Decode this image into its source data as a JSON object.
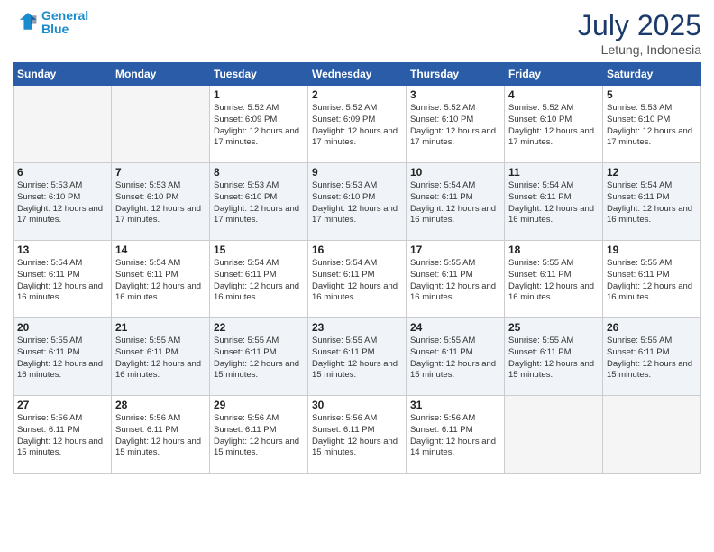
{
  "header": {
    "logo_line1": "General",
    "logo_line2": "Blue",
    "month": "July 2025",
    "location": "Letung, Indonesia"
  },
  "days_of_week": [
    "Sunday",
    "Monday",
    "Tuesday",
    "Wednesday",
    "Thursday",
    "Friday",
    "Saturday"
  ],
  "weeks": [
    [
      {
        "day": "",
        "empty": true
      },
      {
        "day": "",
        "empty": true
      },
      {
        "day": "1",
        "sunrise": "Sunrise: 5:52 AM",
        "sunset": "Sunset: 6:09 PM",
        "daylight": "Daylight: 12 hours and 17 minutes."
      },
      {
        "day": "2",
        "sunrise": "Sunrise: 5:52 AM",
        "sunset": "Sunset: 6:09 PM",
        "daylight": "Daylight: 12 hours and 17 minutes."
      },
      {
        "day": "3",
        "sunrise": "Sunrise: 5:52 AM",
        "sunset": "Sunset: 6:10 PM",
        "daylight": "Daylight: 12 hours and 17 minutes."
      },
      {
        "day": "4",
        "sunrise": "Sunrise: 5:52 AM",
        "sunset": "Sunset: 6:10 PM",
        "daylight": "Daylight: 12 hours and 17 minutes."
      },
      {
        "day": "5",
        "sunrise": "Sunrise: 5:53 AM",
        "sunset": "Sunset: 6:10 PM",
        "daylight": "Daylight: 12 hours and 17 minutes."
      }
    ],
    [
      {
        "day": "6",
        "sunrise": "Sunrise: 5:53 AM",
        "sunset": "Sunset: 6:10 PM",
        "daylight": "Daylight: 12 hours and 17 minutes."
      },
      {
        "day": "7",
        "sunrise": "Sunrise: 5:53 AM",
        "sunset": "Sunset: 6:10 PM",
        "daylight": "Daylight: 12 hours and 17 minutes."
      },
      {
        "day": "8",
        "sunrise": "Sunrise: 5:53 AM",
        "sunset": "Sunset: 6:10 PM",
        "daylight": "Daylight: 12 hours and 17 minutes."
      },
      {
        "day": "9",
        "sunrise": "Sunrise: 5:53 AM",
        "sunset": "Sunset: 6:10 PM",
        "daylight": "Daylight: 12 hours and 17 minutes."
      },
      {
        "day": "10",
        "sunrise": "Sunrise: 5:54 AM",
        "sunset": "Sunset: 6:11 PM",
        "daylight": "Daylight: 12 hours and 16 minutes."
      },
      {
        "day": "11",
        "sunrise": "Sunrise: 5:54 AM",
        "sunset": "Sunset: 6:11 PM",
        "daylight": "Daylight: 12 hours and 16 minutes."
      },
      {
        "day": "12",
        "sunrise": "Sunrise: 5:54 AM",
        "sunset": "Sunset: 6:11 PM",
        "daylight": "Daylight: 12 hours and 16 minutes."
      }
    ],
    [
      {
        "day": "13",
        "sunrise": "Sunrise: 5:54 AM",
        "sunset": "Sunset: 6:11 PM",
        "daylight": "Daylight: 12 hours and 16 minutes."
      },
      {
        "day": "14",
        "sunrise": "Sunrise: 5:54 AM",
        "sunset": "Sunset: 6:11 PM",
        "daylight": "Daylight: 12 hours and 16 minutes."
      },
      {
        "day": "15",
        "sunrise": "Sunrise: 5:54 AM",
        "sunset": "Sunset: 6:11 PM",
        "daylight": "Daylight: 12 hours and 16 minutes."
      },
      {
        "day": "16",
        "sunrise": "Sunrise: 5:54 AM",
        "sunset": "Sunset: 6:11 PM",
        "daylight": "Daylight: 12 hours and 16 minutes."
      },
      {
        "day": "17",
        "sunrise": "Sunrise: 5:55 AM",
        "sunset": "Sunset: 6:11 PM",
        "daylight": "Daylight: 12 hours and 16 minutes."
      },
      {
        "day": "18",
        "sunrise": "Sunrise: 5:55 AM",
        "sunset": "Sunset: 6:11 PM",
        "daylight": "Daylight: 12 hours and 16 minutes."
      },
      {
        "day": "19",
        "sunrise": "Sunrise: 5:55 AM",
        "sunset": "Sunset: 6:11 PM",
        "daylight": "Daylight: 12 hours and 16 minutes."
      }
    ],
    [
      {
        "day": "20",
        "sunrise": "Sunrise: 5:55 AM",
        "sunset": "Sunset: 6:11 PM",
        "daylight": "Daylight: 12 hours and 16 minutes."
      },
      {
        "day": "21",
        "sunrise": "Sunrise: 5:55 AM",
        "sunset": "Sunset: 6:11 PM",
        "daylight": "Daylight: 12 hours and 16 minutes."
      },
      {
        "day": "22",
        "sunrise": "Sunrise: 5:55 AM",
        "sunset": "Sunset: 6:11 PM",
        "daylight": "Daylight: 12 hours and 15 minutes."
      },
      {
        "day": "23",
        "sunrise": "Sunrise: 5:55 AM",
        "sunset": "Sunset: 6:11 PM",
        "daylight": "Daylight: 12 hours and 15 minutes."
      },
      {
        "day": "24",
        "sunrise": "Sunrise: 5:55 AM",
        "sunset": "Sunset: 6:11 PM",
        "daylight": "Daylight: 12 hours and 15 minutes."
      },
      {
        "day": "25",
        "sunrise": "Sunrise: 5:55 AM",
        "sunset": "Sunset: 6:11 PM",
        "daylight": "Daylight: 12 hours and 15 minutes."
      },
      {
        "day": "26",
        "sunrise": "Sunrise: 5:55 AM",
        "sunset": "Sunset: 6:11 PM",
        "daylight": "Daylight: 12 hours and 15 minutes."
      }
    ],
    [
      {
        "day": "27",
        "sunrise": "Sunrise: 5:56 AM",
        "sunset": "Sunset: 6:11 PM",
        "daylight": "Daylight: 12 hours and 15 minutes."
      },
      {
        "day": "28",
        "sunrise": "Sunrise: 5:56 AM",
        "sunset": "Sunset: 6:11 PM",
        "daylight": "Daylight: 12 hours and 15 minutes."
      },
      {
        "day": "29",
        "sunrise": "Sunrise: 5:56 AM",
        "sunset": "Sunset: 6:11 PM",
        "daylight": "Daylight: 12 hours and 15 minutes."
      },
      {
        "day": "30",
        "sunrise": "Sunrise: 5:56 AM",
        "sunset": "Sunset: 6:11 PM",
        "daylight": "Daylight: 12 hours and 15 minutes."
      },
      {
        "day": "31",
        "sunrise": "Sunrise: 5:56 AM",
        "sunset": "Sunset: 6:11 PM",
        "daylight": "Daylight: 12 hours and 14 minutes."
      },
      {
        "day": "",
        "empty": true
      },
      {
        "day": "",
        "empty": true
      }
    ]
  ]
}
